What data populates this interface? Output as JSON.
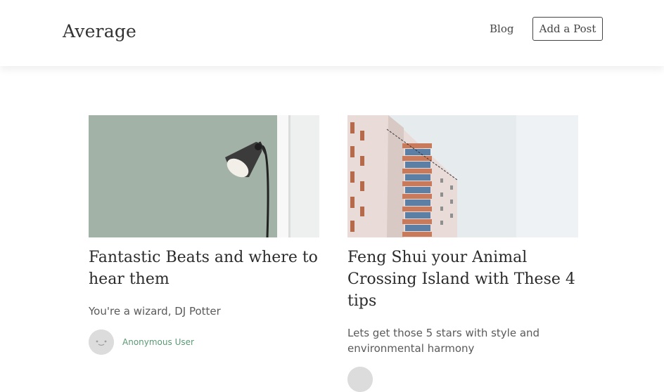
{
  "header": {
    "logo": "Average",
    "nav_blog": "Blog",
    "nav_add_post": "Add a Post"
  },
  "posts": [
    {
      "title": "Fantastic Beats and where to hear them",
      "excerpt": "You're a wizard, DJ Potter",
      "author": "Anonymous User",
      "image": "floor-lamp-photo"
    },
    {
      "title": "Feng Shui your Animal Crossing Island with These 4 tips",
      "excerpt": "Lets get those 5 stars with style and environmental harmony",
      "author": "",
      "image": "apartment-building-photo"
    }
  ],
  "colors": {
    "author_link": "#5a9a74",
    "text_dark": "#2b2b2b",
    "text_muted": "#5a5a5a"
  }
}
